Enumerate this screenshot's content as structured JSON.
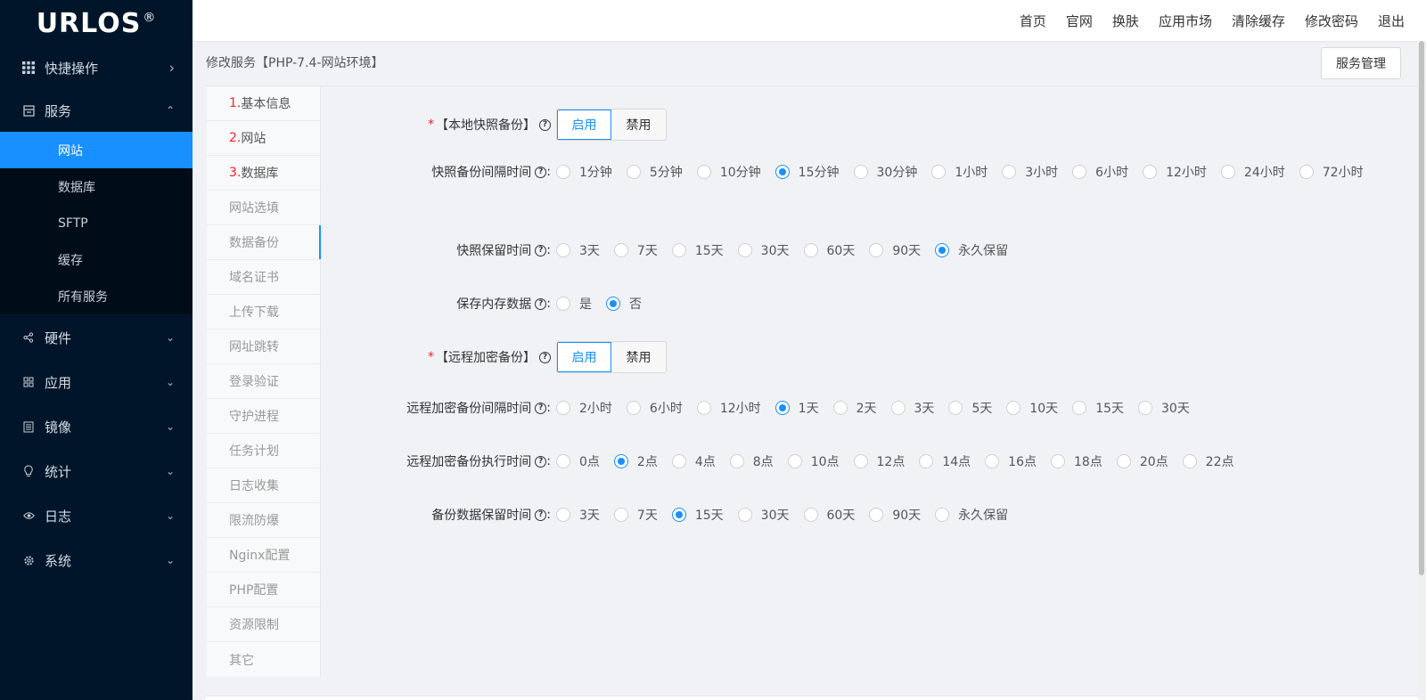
{
  "brand": {
    "name": "URLOS",
    "mark": "®"
  },
  "sidebar": {
    "top": {
      "label": "快捷操作",
      "icon": "grid-icon"
    },
    "service": {
      "label": "服务",
      "subitems": [
        "网站",
        "数据库",
        "SFTP",
        "缓存",
        "所有服务"
      ]
    },
    "groups": [
      {
        "label": "硬件",
        "icon": "share-icon"
      },
      {
        "label": "应用",
        "icon": "apps-icon"
      },
      {
        "label": "镜像",
        "icon": "list-icon"
      },
      {
        "label": "统计",
        "icon": "bulb-icon"
      },
      {
        "label": "日志",
        "icon": "eye-icon"
      },
      {
        "label": "系统",
        "icon": "gear-icon"
      }
    ]
  },
  "topnav": [
    "首页",
    "官网",
    "换肤",
    "应用市场",
    "清除缓存",
    "修改密码",
    "退出"
  ],
  "breadcrumb": "修改服务【PHP-7.4-网站环境】",
  "service_button": "服务管理",
  "steps": [
    {
      "num": "1.",
      "label": "基本信息"
    },
    {
      "num": "2.",
      "label": "网站"
    },
    {
      "num": "3.",
      "label": "数据库"
    },
    {
      "label": "网站选填"
    },
    {
      "label": "数据备份"
    },
    {
      "label": "域名证书"
    },
    {
      "label": "上传下载"
    },
    {
      "label": "网址跳转"
    },
    {
      "label": "登录验证"
    },
    {
      "label": "守护进程"
    },
    {
      "label": "任务计划"
    },
    {
      "label": "日志收集"
    },
    {
      "label": "限流防爆"
    },
    {
      "label": "Nginx配置"
    },
    {
      "label": "PHP配置"
    },
    {
      "label": "资源限制"
    },
    {
      "label": "其它"
    }
  ],
  "form": {
    "local_snapshot": {
      "label": "【本地快照备份】",
      "enable": "启用",
      "disable": "禁用",
      "value": "启用"
    },
    "snapshot_interval": {
      "label": "快照备份间隔时间",
      "options": [
        "1分钟",
        "5分钟",
        "10分钟",
        "15分钟",
        "30分钟",
        "1小时",
        "3小时",
        "6小时",
        "12小时",
        "24小时",
        "72小时"
      ],
      "selected": "15分钟"
    },
    "snapshot_retention": {
      "label": "快照保留时间",
      "options": [
        "3天",
        "7天",
        "15天",
        "30天",
        "60天",
        "90天",
        "永久保留"
      ],
      "selected": "永久保留"
    },
    "save_memory": {
      "label": "保存内存数据",
      "options": [
        "是",
        "否"
      ],
      "selected": "否"
    },
    "remote_backup": {
      "label": "【远程加密备份】",
      "enable": "启用",
      "disable": "禁用",
      "value": "启用"
    },
    "remote_interval": {
      "label": "远程加密备份间隔时间",
      "options": [
        "2小时",
        "6小时",
        "12小时",
        "1天",
        "2天",
        "3天",
        "5天",
        "10天",
        "15天",
        "30天"
      ],
      "selected": "1天"
    },
    "remote_exec_time": {
      "label": "远程加密备份执行时间",
      "options": [
        "0点",
        "2点",
        "4点",
        "8点",
        "10点",
        "12点",
        "14点",
        "16点",
        "18点",
        "20点",
        "22点"
      ],
      "selected": "2点"
    },
    "backup_retention": {
      "label": "备份数据保留时间",
      "options": [
        "3天",
        "7天",
        "15天",
        "30天",
        "60天",
        "90天",
        "永久保留"
      ],
      "selected": "15天"
    }
  },
  "colors": {
    "sidebar_bg": "#001529",
    "accent": "#1890ff",
    "required": "#f5222d"
  }
}
